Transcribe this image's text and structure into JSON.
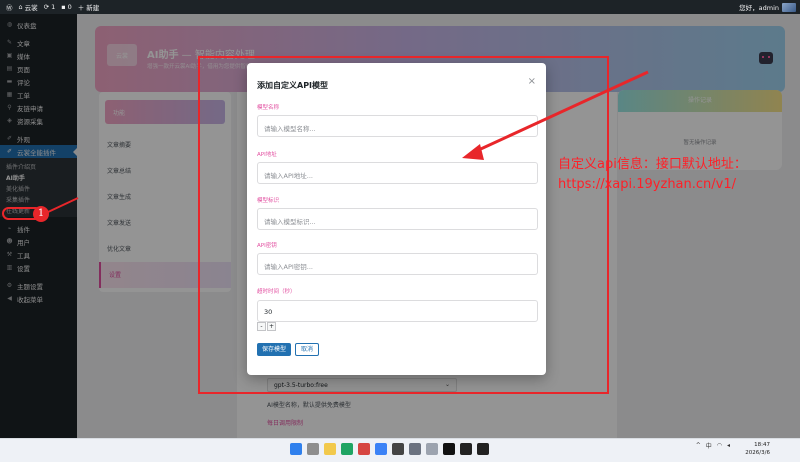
{
  "adminbar": {
    "site_name": "云裳",
    "updates": "1",
    "comments": "0",
    "new_label": "新建",
    "greeting": "您好，admin"
  },
  "sidebar": {
    "items": [
      {
        "label": "仪表盘",
        "icon": "dashboard-icon"
      },
      {
        "label": "文章",
        "icon": "pin-icon"
      },
      {
        "label": "媒体",
        "icon": "media-icon"
      },
      {
        "label": "页面",
        "icon": "page-icon"
      },
      {
        "label": "评论",
        "icon": "comment-icon"
      },
      {
        "label": "工单",
        "icon": "ticket-icon"
      },
      {
        "label": "友链申请",
        "icon": "link-icon"
      },
      {
        "label": "资源采集",
        "icon": "collect-icon"
      },
      {
        "label": "外观",
        "icon": "brush-icon"
      },
      {
        "label": "云裳全能插件",
        "icon": "plugin-icon"
      }
    ],
    "submenu": [
      "插件介绍页",
      "AI助手",
      "美化插件",
      "采集插件",
      "在线更新"
    ],
    "bottom_items": [
      {
        "label": "插件",
        "icon": "plug-icon"
      },
      {
        "label": "用户",
        "icon": "user-icon"
      },
      {
        "label": "工具",
        "icon": "wrench-icon"
      },
      {
        "label": "设置",
        "icon": "settings-icon"
      },
      {
        "label": "主题设置",
        "icon": "gear-icon"
      },
      {
        "label": "收起菜单",
        "icon": "collapse-icon"
      }
    ]
  },
  "hero": {
    "logo_text": "云裳",
    "title_main": "AI助手",
    "title_sub": " — 智能内容处理",
    "desc": "增强一款开云裳AI助手，借用为您提供智能内容处理服务"
  },
  "leftnav": {
    "head": "功能",
    "items": [
      "文章摘要",
      "文章总结",
      "文章生成",
      "文章发送",
      "优化文章",
      "设置"
    ]
  },
  "content": {
    "model_select": "gpt-3.5-turbo:free",
    "note": "AI模型名称，默认提供免费模型",
    "section": "每日调用限制"
  },
  "record_card": {
    "title": "操作记录",
    "empty": "暂无操作记录"
  },
  "modal": {
    "title": "添加自定义API模型",
    "fields": [
      {
        "label": "模型名称",
        "placeholder": "请输入模型名称..."
      },
      {
        "label": "API地址",
        "placeholder": "请输入API地址..."
      },
      {
        "label": "模型标识",
        "placeholder": "请输入模型标识..."
      },
      {
        "label": "API密钥",
        "placeholder": "请输入API密钥..."
      }
    ],
    "timeout_label": "超时时间（秒）",
    "timeout_value": "30",
    "minus": "-",
    "plus": "+",
    "save_label": "保存模型",
    "cancel_label": "取消"
  },
  "annotation": {
    "line1": "自定义api信息：接口默认地址：",
    "line2": "https://xapi.19yzhan.cn/v1/",
    "badge": "1",
    "color": "#e8262a"
  },
  "taskbar": {
    "time": "18:47",
    "date": "2026/3/6",
    "lang": "中"
  }
}
